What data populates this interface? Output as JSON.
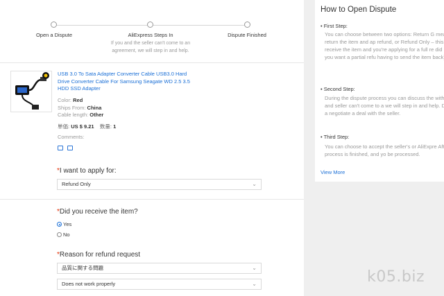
{
  "steps": [
    {
      "label": "Open a Dispute"
    },
    {
      "label": "AliExpress Steps In",
      "note": "If you and the seller can't come to an agreement, we will step in and help."
    },
    {
      "label": "Dispute Finished"
    }
  ],
  "product": {
    "title": "USB 3.0 To Sata Adapter Converter Cable USB3.0 Hard Drive Converter Cable For Samsung Seagate WD 2.5 3.5 HDD SSD Adapter",
    "color_label": "Color:",
    "color_value": "Red",
    "ships_label": "Ships From:",
    "ships_value": "China",
    "cable_label": "Cable length:",
    "cable_value": "Other",
    "price_label": "単価:",
    "price_value": "US $ 9.21",
    "qty_label": "数量:",
    "qty_value": "1",
    "comments_label": "Comments:"
  },
  "form": {
    "apply_label": "I want to apply for:",
    "apply_value": "Refund Only",
    "received_label": "Did you receive the item?",
    "received_yes": "Yes",
    "received_no": "No",
    "reason_label": "Reason for refund request",
    "reason_value": "品質に関する問題",
    "reason_detail_value": "Does not work properly",
    "required_mark": "*"
  },
  "guide": {
    "title": "How to Open Dispute",
    "first_label": "• First Step:",
    "first_text": "You can choose between two options: Return G means that you want to return the item and ap refund, or Refund Only – this means that either receive the item and you're applying for a full re did receive the item and you want a partial refu having to send the item back).",
    "second_label": "• Second Step:",
    "second_text": "During the dispute process you can discuss the with the seller. If you and seller can't come to a we will step in and help. During this time, you a negotiate a deal with the seller.",
    "third_label": "• Third Step:",
    "third_text": "You can choose to accept the seller's or AliExpre After this, the dispute process is finished, and yo be processed.",
    "view_more": "View More"
  },
  "watermark": "k05.biz",
  "colors": {
    "link": "#1a6fd6",
    "required": "#e62e04"
  }
}
